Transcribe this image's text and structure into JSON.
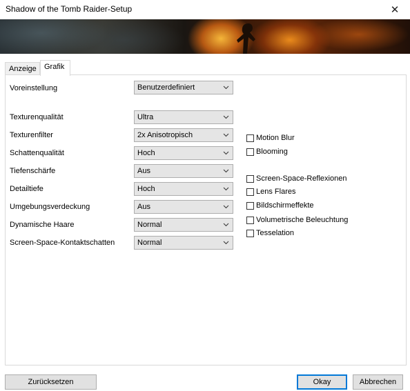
{
  "window": {
    "title": "Shadow of the Tomb Raider-Setup",
    "close_glyph": "✕"
  },
  "tabs": [
    {
      "label": "Anzeige",
      "active": false
    },
    {
      "label": "Grafik",
      "active": true
    }
  ],
  "preset": {
    "label": "Voreinstellung",
    "value": "Benutzerdefiniert"
  },
  "settings": [
    {
      "label": "Texturenqualität",
      "value": "Ultra"
    },
    {
      "label": "Texturenfilter",
      "value": "2x Anisotropisch"
    },
    {
      "label": "Schattenqualität",
      "value": "Hoch"
    },
    {
      "label": "Tiefenschärfe",
      "value": "Aus"
    },
    {
      "label": "Detailtiefe",
      "value": "Hoch"
    },
    {
      "label": "Umgebungsverdeckung",
      "value": "Aus"
    },
    {
      "label": "Dynamische Haare",
      "value": "Normal"
    },
    {
      "label": "Screen-Space-Kontaktschatten",
      "value": "Normal"
    }
  ],
  "checkboxes": [
    {
      "label": "Motion Blur",
      "checked": false
    },
    {
      "label": "Blooming",
      "checked": false
    },
    {
      "label": "Screen-Space-Reflexionen",
      "checked": false
    },
    {
      "label": "Lens Flares",
      "checked": false
    },
    {
      "label": "Bildschirmeffekte",
      "checked": false
    },
    {
      "label": "Volumetrische Beleuchtung",
      "checked": false
    },
    {
      "label": "Tesselation",
      "checked": false
    }
  ],
  "buttons": {
    "reset": "Zurücksetzen",
    "ok": "Okay",
    "cancel": "Abbrechen"
  },
  "colors": {
    "accent": "#0078d7",
    "banner_fire": "#e8741a"
  }
}
